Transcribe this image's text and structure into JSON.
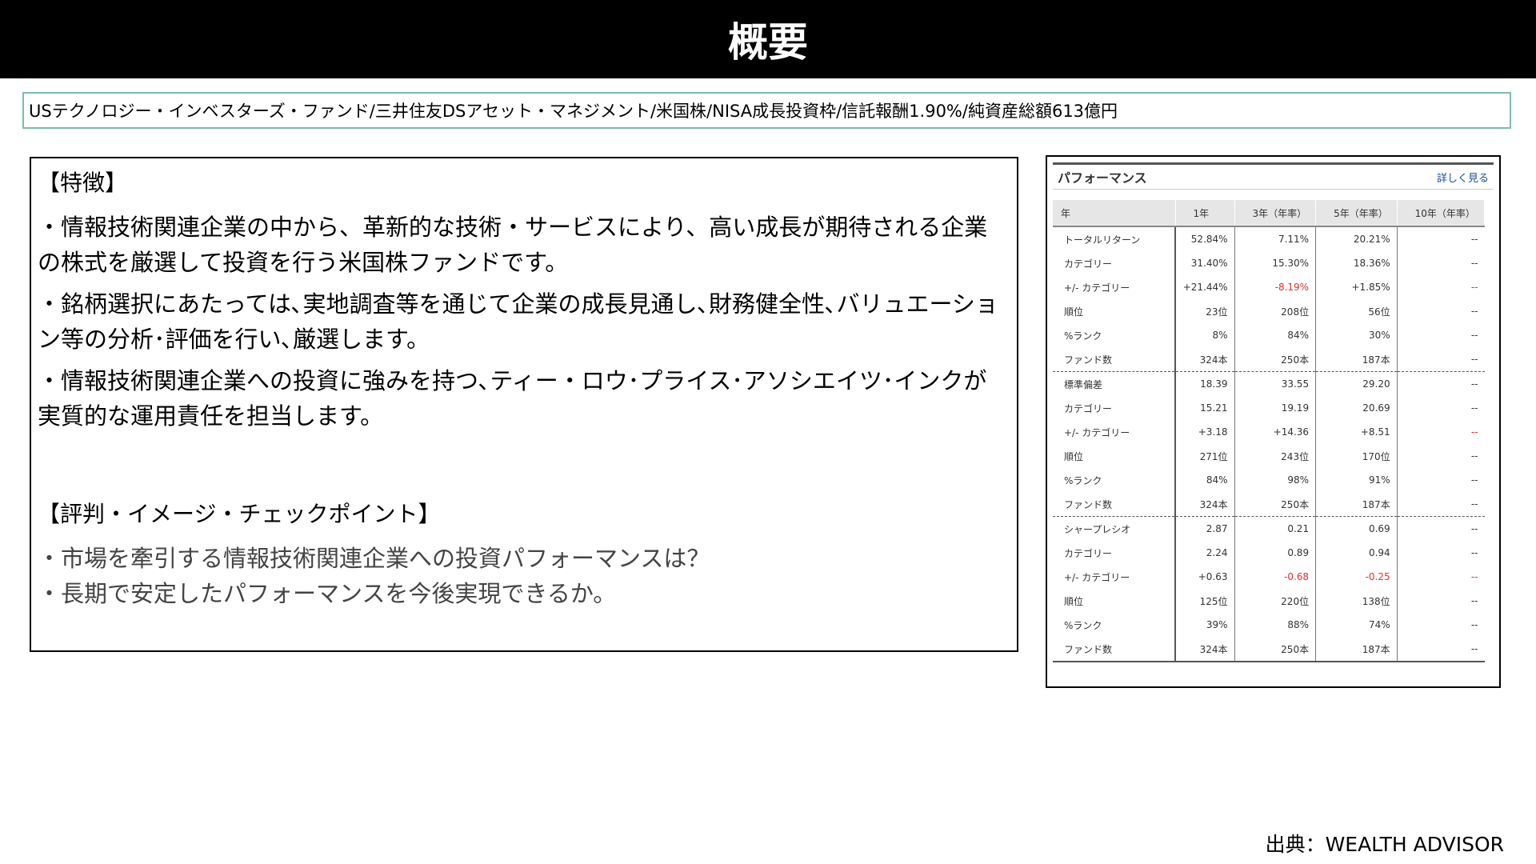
{
  "title": "概要",
  "summary": "USテクノロジー・インベスターズ・ファンド/三井住友DSアセット・マネジメント/米国株/NISA成長投資枠/信託報酬1.90%/純資産総額613億円",
  "features": {
    "heading": "【特徴】",
    "points": [
      "・情報技術関連企業の中から、革新的な技術・サービスにより、高い成長が期待される企業の株式を厳選して投資を行う米国株ファンドです。",
      "・銘柄選択にあたっては､実地調査等を通じて企業の成長見通し､財務健全性､バリュエーション等の分析･評価を行い､厳選します。",
      "・情報技術関連企業への投資に強みを持つ､ティー・ロウ･プライス･アソシエイツ･インクが実質的な運用責任を担当します。"
    ],
    "check_heading": "【評判・イメージ・チェックポイント】",
    "checks": [
      "・市場を牽引する情報技術関連企業への投資パフォーマンスは？",
      "・長期で安定したパフォーマンスを今後実現できるか。"
    ]
  },
  "performance": {
    "title": "パフォーマンス",
    "detail_link": "詳しく見る",
    "columns": [
      "年",
      "1年",
      "3年（年率）",
      "5年（年率）",
      "10年（年率）"
    ],
    "groups": [
      [
        {
          "label": "トータルリターン",
          "values": [
            "52.84%",
            "7.11%",
            "20.21%",
            "--"
          ]
        },
        {
          "label": "カテゴリー",
          "values": [
            "31.40%",
            "15.30%",
            "18.36%",
            "--"
          ]
        },
        {
          "label": "+/- カテゴリー",
          "values": [
            "+21.44%",
            "-8.19%",
            "+1.85%",
            "--"
          ]
        },
        {
          "label": "順位",
          "values": [
            "23位",
            "208位",
            "56位",
            "--"
          ]
        },
        {
          "label": "%ランク",
          "values": [
            "8%",
            "84%",
            "30%",
            "--"
          ]
        },
        {
          "label": "ファンド数",
          "values": [
            "324本",
            "250本",
            "187本",
            "--"
          ]
        }
      ],
      [
        {
          "label": "標準偏差",
          "values": [
            "18.39",
            "33.55",
            "29.20",
            "--"
          ]
        },
        {
          "label": "カテゴリー",
          "values": [
            "15.21",
            "19.19",
            "20.69",
            "--"
          ]
        },
        {
          "label": "+/- カテゴリー",
          "values": [
            "+3.18",
            "+14.36",
            "+8.51",
            "--"
          ]
        },
        {
          "label": "順位",
          "values": [
            "271位",
            "243位",
            "170位",
            "--"
          ]
        },
        {
          "label": "%ランク",
          "values": [
            "84%",
            "98%",
            "91%",
            "--"
          ]
        },
        {
          "label": "ファンド数",
          "values": [
            "324本",
            "250本",
            "187本",
            "--"
          ]
        }
      ],
      [
        {
          "label": "シャープレシオ",
          "values": [
            "2.87",
            "0.21",
            "0.69",
            "--"
          ]
        },
        {
          "label": "カテゴリー",
          "values": [
            "2.24",
            "0.89",
            "0.94",
            "--"
          ]
        },
        {
          "label": "+/- カテゴリー",
          "values": [
            "+0.63",
            "-0.68",
            "-0.25",
            "--"
          ]
        },
        {
          "label": "順位",
          "values": [
            "125位",
            "220位",
            "138位",
            "--"
          ]
        },
        {
          "label": "%ランク",
          "values": [
            "39%",
            "88%",
            "74%",
            "--"
          ]
        },
        {
          "label": "ファンド数",
          "values": [
            "324本",
            "250本",
            "187本",
            "--"
          ]
        }
      ]
    ],
    "negative_color": "#e03030"
  },
  "source": "出典：WEALTH ADVISOR"
}
